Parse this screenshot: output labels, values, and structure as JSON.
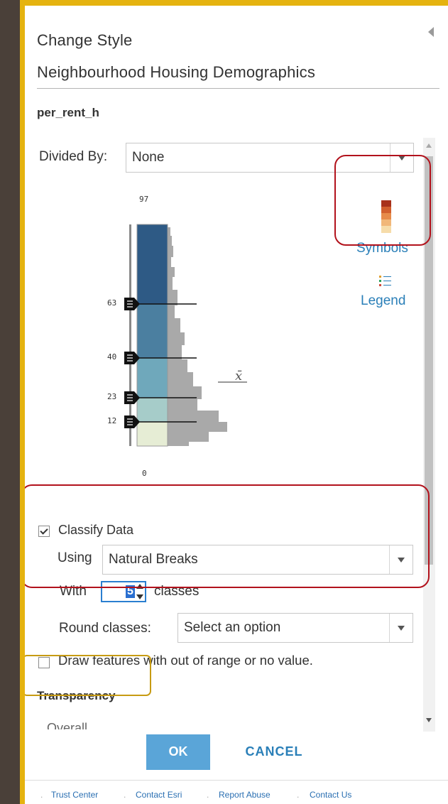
{
  "panel": {
    "title": "Change Style",
    "layer_name": "Neighbourhood Housing Demographics",
    "field_name": "per_rent_h"
  },
  "divided_by": {
    "label": "Divided By:",
    "value": "None"
  },
  "histogram": {
    "max_label": "97",
    "min_label": "0",
    "break_labels": [
      "63",
      "40",
      "23",
      "12"
    ],
    "mean_symbol": "x̄",
    "class_colors": [
      "#2e5a85",
      "#4b7fa0",
      "#6fa8bb",
      "#a6ccc9",
      "#e6edd5"
    ]
  },
  "side_tools": {
    "symbols_label": "Symbols",
    "legend_label": "Legend",
    "ramp_colors": [
      "#a8321b",
      "#d2602e",
      "#e78b4a",
      "#f1b779",
      "#f6dcaa"
    ]
  },
  "classify": {
    "checkbox_label": "Classify Data",
    "checked": true,
    "using_label": "Using",
    "method": "Natural Breaks",
    "with_label": "With",
    "classes_value": "5",
    "classes_suffix": "classes",
    "round_label": "Round classes:",
    "round_placeholder": "Select an option"
  },
  "out_of_range": {
    "label": "Draw features with out of range or no value.",
    "checked": false
  },
  "transparency": {
    "heading": "Transparency",
    "overall_label": "Overall"
  },
  "buttons": {
    "ok": "OK",
    "cancel": "CANCEL"
  },
  "footer": {
    "links": [
      "Trust Center",
      "Contact Esri",
      "Report Abuse",
      "Contact Us"
    ]
  },
  "colors": {
    "accent": "#5aa5d8",
    "link": "#2a7fb8",
    "frame": "#e5b30f",
    "annotation_red": "#b2121c"
  }
}
